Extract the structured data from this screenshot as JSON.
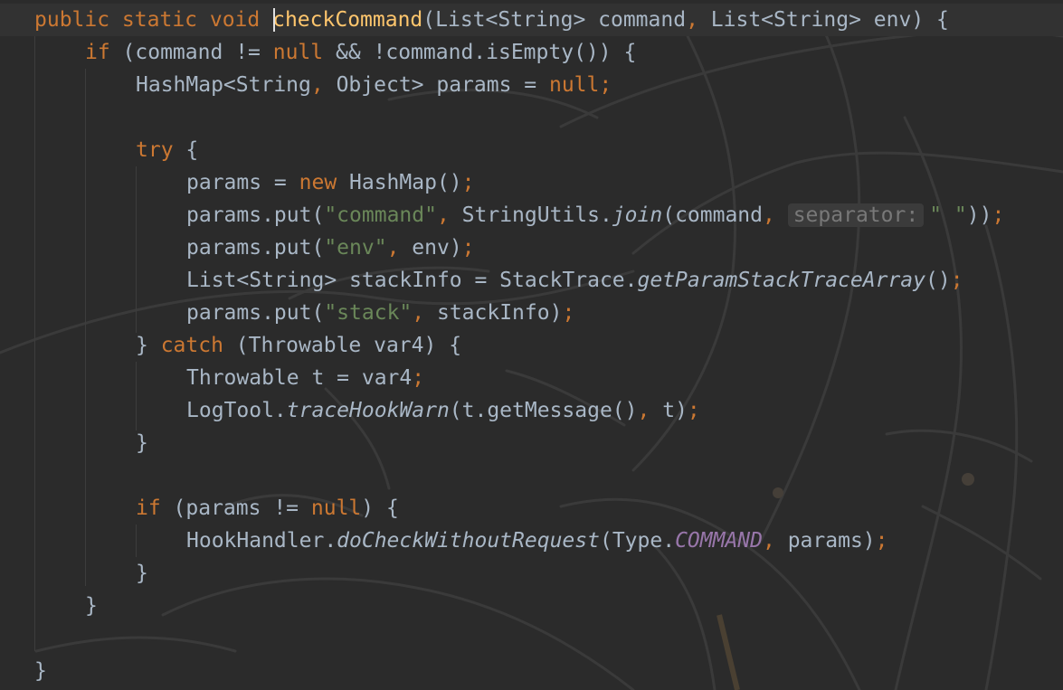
{
  "code": {
    "lines": [
      {
        "tokens": [
          {
            "t": "public static void ",
            "c": "kw"
          },
          {
            "t": "checkCommand",
            "c": "fn"
          },
          {
            "t": "(List<String> command",
            "c": ""
          },
          {
            "t": ", ",
            "c": "kw"
          },
          {
            "t": "List<String> env) {",
            "c": ""
          }
        ]
      },
      {
        "tokens": [
          {
            "t": "if ",
            "c": "kw"
          },
          {
            "t": "(command != ",
            "c": ""
          },
          {
            "t": "null ",
            "c": "kw"
          },
          {
            "t": "&& !command.isEmpty()) {",
            "c": ""
          }
        ]
      },
      {
        "tokens": [
          {
            "t": "HashMap<String",
            "c": ""
          },
          {
            "t": ", ",
            "c": "kw"
          },
          {
            "t": "Object> params = ",
            "c": ""
          },
          {
            "t": "null;",
            "c": "kw"
          }
        ]
      },
      {
        "tokens": []
      },
      {
        "tokens": [
          {
            "t": "try ",
            "c": "kw"
          },
          {
            "t": "{",
            "c": ""
          }
        ]
      },
      {
        "tokens": [
          {
            "t": "params = ",
            "c": ""
          },
          {
            "t": "new ",
            "c": "kw"
          },
          {
            "t": "HashMap()",
            "c": ""
          },
          {
            "t": ";",
            "c": "kw"
          }
        ]
      },
      {
        "tokens": [
          {
            "t": "params.put(",
            "c": ""
          },
          {
            "t": "\"command\"",
            "c": "str"
          },
          {
            "t": ", ",
            "c": "kw"
          },
          {
            "t": "StringUtils.",
            "c": ""
          },
          {
            "t": "join",
            "c": "it"
          },
          {
            "t": "(command",
            "c": ""
          },
          {
            "t": ", ",
            "c": "kw"
          },
          {
            "t": "separator:",
            "c": "hint"
          },
          {
            "t": "\" \"",
            "c": "str"
          },
          {
            "t": "))",
            "c": ""
          },
          {
            "t": ";",
            "c": "kw"
          }
        ]
      },
      {
        "tokens": [
          {
            "t": "params.put(",
            "c": ""
          },
          {
            "t": "\"env\"",
            "c": "str"
          },
          {
            "t": ", ",
            "c": "kw"
          },
          {
            "t": "env)",
            "c": ""
          },
          {
            "t": ";",
            "c": "kw"
          }
        ]
      },
      {
        "tokens": [
          {
            "t": "List<String> stackInfo = StackTrace.",
            "c": ""
          },
          {
            "t": "getParamStackTraceArray",
            "c": "it"
          },
          {
            "t": "()",
            "c": ""
          },
          {
            "t": ";",
            "c": "kw"
          }
        ]
      },
      {
        "tokens": [
          {
            "t": "params.put(",
            "c": ""
          },
          {
            "t": "\"stack\"",
            "c": "str"
          },
          {
            "t": ", ",
            "c": "kw"
          },
          {
            "t": "stackInfo)",
            "c": ""
          },
          {
            "t": ";",
            "c": "kw"
          }
        ]
      },
      {
        "tokens": [
          {
            "t": "} ",
            "c": ""
          },
          {
            "t": "catch ",
            "c": "kw"
          },
          {
            "t": "(Throwable var4) {",
            "c": ""
          }
        ]
      },
      {
        "tokens": [
          {
            "t": "Throwable t = var4",
            "c": ""
          },
          {
            "t": ";",
            "c": "kw"
          }
        ]
      },
      {
        "tokens": [
          {
            "t": "LogTool.",
            "c": ""
          },
          {
            "t": "traceHookWarn",
            "c": "it"
          },
          {
            "t": "(t.getMessage()",
            "c": ""
          },
          {
            "t": ", ",
            "c": "kw"
          },
          {
            "t": "t)",
            "c": ""
          },
          {
            "t": ";",
            "c": "kw"
          }
        ]
      },
      {
        "tokens": [
          {
            "t": "}",
            "c": ""
          }
        ]
      },
      {
        "tokens": []
      },
      {
        "tokens": [
          {
            "t": "if ",
            "c": "kw"
          },
          {
            "t": "(params != ",
            "c": ""
          },
          {
            "t": "null",
            "c": "kw"
          },
          {
            "t": ") {",
            "c": ""
          }
        ]
      },
      {
        "tokens": [
          {
            "t": "HookHandler.",
            "c": ""
          },
          {
            "t": "doCheckWithoutRequest",
            "c": "it"
          },
          {
            "t": "(Type.",
            "c": ""
          },
          {
            "t": "COMMAND",
            "c": "const"
          },
          {
            "t": ", ",
            "c": "kw"
          },
          {
            "t": "params)",
            "c": ""
          },
          {
            "t": ";",
            "c": "kw"
          }
        ]
      },
      {
        "tokens": [
          {
            "t": "}",
            "c": ""
          }
        ]
      },
      {
        "tokens": [
          {
            "t": "}",
            "c": ""
          }
        ]
      },
      {
        "tokens": []
      },
      {
        "tokens": [
          {
            "t": "}",
            "c": ""
          }
        ]
      }
    ]
  },
  "colors": {
    "background": "#2b2b2b",
    "text": "#a9b7c6",
    "keyword": "#cc7832",
    "method_declaration": "#ffc66d",
    "string": "#6a8759",
    "constant": "#9876aa",
    "inlay_hint_text": "#787878"
  }
}
